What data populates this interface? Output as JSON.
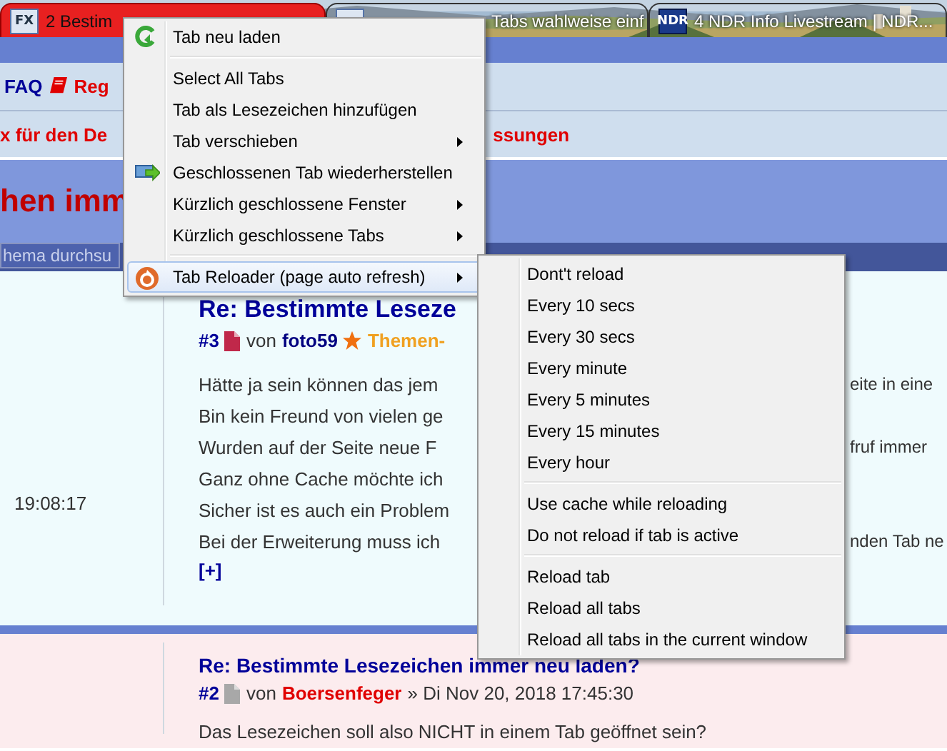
{
  "tabs": [
    {
      "label": "2 Bestim",
      "icon_label": "FX",
      "selected": true
    },
    {
      "label": "Tabs wahlweise einf",
      "selected": false
    },
    {
      "label": "4 NDR Info Livestream | NDR...",
      "icon_label": "NDR",
      "selected": false
    }
  ],
  "nav_links": [
    {
      "label": "FAQ",
      "kind": "faq"
    },
    {
      "label": "Reg",
      "kind": "register"
    }
  ],
  "notice": [
    "x für den De",
    "ssungen"
  ],
  "topic_title": "hen imm",
  "search": {
    "placeholder": "hema durchsu"
  },
  "posts": [
    {
      "time": "19:08:17",
      "title": "Re: Bestimmte Leseze",
      "number": "#3",
      "new": true,
      "by": "von",
      "author": {
        "name": "foto59",
        "color": "#000080"
      },
      "rank": "Themen-",
      "lines": [
        {
          "left": "Hätte ja sein können das jem",
          "right": "eite in eine"
        },
        {
          "left": "Bin kein Freund von vielen ge"
        },
        {
          "left": "Wurden auf der Seite neue F",
          "right": "fruf immer"
        },
        {
          "left": "Ganz ohne Cache möchte ich"
        },
        {
          "left": "Sicher ist es auch ein Problem"
        },
        {
          "left": "Bei der Erweiterung muss ich",
          "right": "nden Tab ne"
        }
      ],
      "more": "[+]"
    },
    {
      "title": "Re: Bestimmte Lesezeichen immer neu laden?",
      "number": "#2",
      "new": false,
      "by": "von",
      "author": {
        "name": "Boersenfeger",
        "color": "#e00000"
      },
      "date": "» Di Nov 20, 2018 17:45:30",
      "lines": [
        {
          "left": "Das Lesezeichen soll also NICHT in einem Tab geöffnet sein?"
        }
      ]
    }
  ],
  "context_menu": {
    "items": [
      {
        "kind": "reload",
        "label": "Tab neu laden",
        "submenu": false,
        "selected": false
      },
      {
        "kind": "separator"
      },
      {
        "kind": "plain",
        "label": "Select All Tabs",
        "submenu": false,
        "selected": false
      },
      {
        "kind": "plain",
        "label": "Tab als Lesezeichen hinzufügen",
        "submenu": false,
        "selected": false
      },
      {
        "kind": "plain",
        "label": "Tab verschieben",
        "submenu": true,
        "selected": false
      },
      {
        "kind": "restore",
        "label": "Geschlossenen Tab wiederherstellen",
        "submenu": false,
        "selected": false
      },
      {
        "kind": "plain",
        "label": "Kürzlich geschlossene Fenster",
        "submenu": true,
        "selected": false
      },
      {
        "kind": "plain",
        "label": "Kürzlich geschlossene Tabs",
        "submenu": true,
        "selected": false
      },
      {
        "kind": "separator"
      },
      {
        "kind": "reloader",
        "label": "Tab Reloader (page auto refresh)",
        "submenu": true,
        "selected": true
      }
    ]
  },
  "submenu": {
    "items": [
      {
        "kind": "plain",
        "label": "Dont't reload",
        "selected": false
      },
      {
        "kind": "plain",
        "label": "Every 10 secs",
        "selected": false
      },
      {
        "kind": "plain",
        "label": "Every 30 secs",
        "selected": false
      },
      {
        "kind": "plain",
        "label": "Every minute",
        "selected": false
      },
      {
        "kind": "plain",
        "label": "Every 5 minutes",
        "selected": false
      },
      {
        "kind": "plain",
        "label": "Every 15 minutes",
        "selected": false
      },
      {
        "kind": "plain",
        "label": "Every hour",
        "selected": false
      },
      {
        "kind": "separator"
      },
      {
        "kind": "plain",
        "label": "Use cache while reloading",
        "selected": false
      },
      {
        "kind": "plain",
        "label": "Do not reload if tab is active",
        "selected": false
      },
      {
        "kind": "separator"
      },
      {
        "kind": "plain",
        "label": "Reload tab",
        "selected": false
      },
      {
        "kind": "plain",
        "label": "Reload all tabs",
        "selected": false
      },
      {
        "kind": "plain",
        "label": "Reload all tabs in the current window",
        "selected": false
      }
    ]
  }
}
